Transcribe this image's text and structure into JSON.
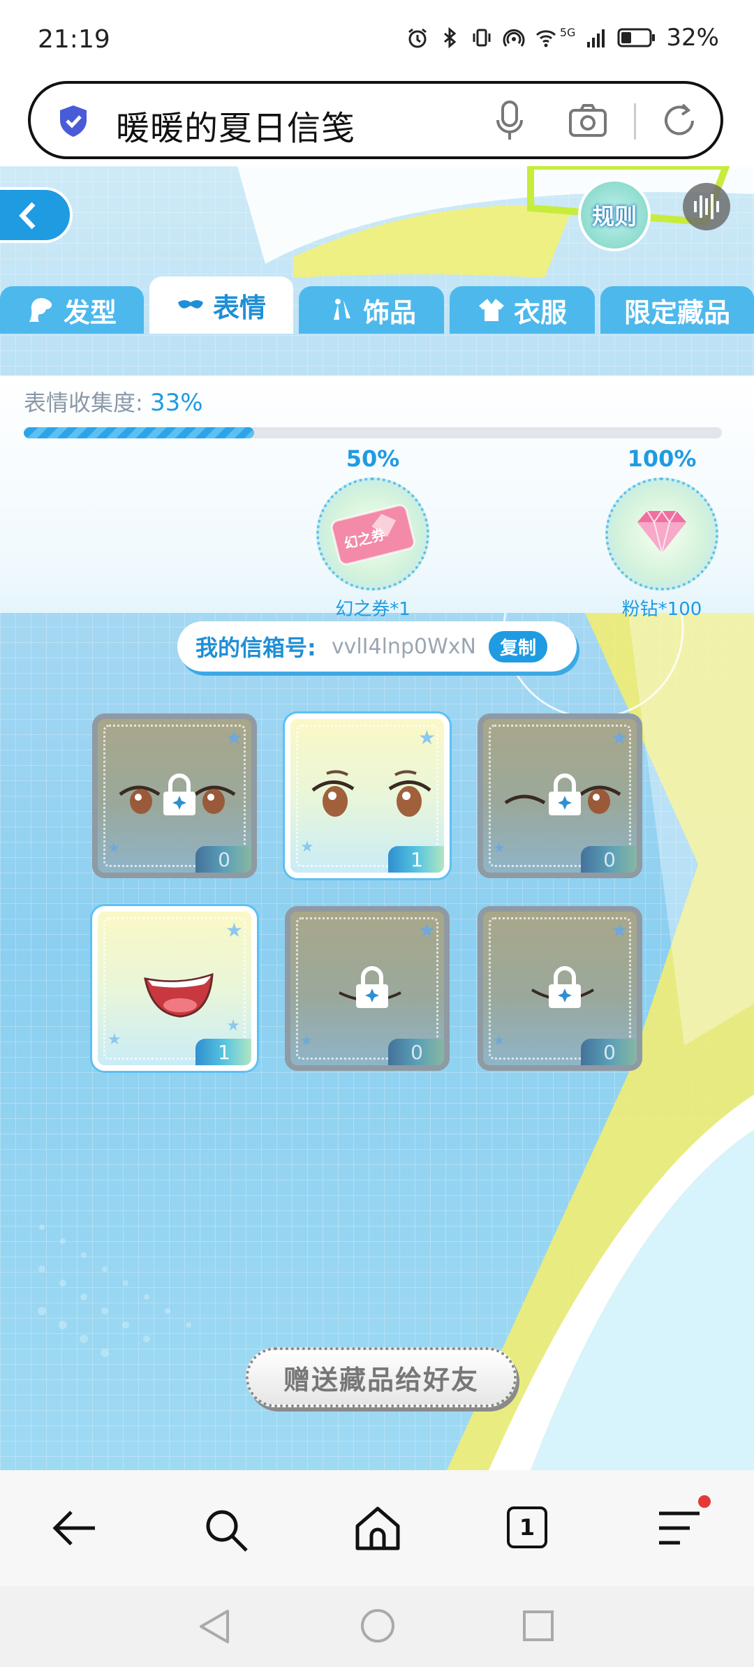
{
  "status_bar": {
    "time": "21:19",
    "network_label": "5G",
    "battery": "32%",
    "icons": [
      "alarm-icon",
      "bluetooth-icon",
      "vibrate-icon",
      "hotspot-icon",
      "wifi-icon",
      "signal-icon",
      "battery-icon"
    ]
  },
  "address_bar": {
    "title": "暖暖的夏日信笺",
    "icons": [
      "shield-icon",
      "mic-icon",
      "camera-icon",
      "reload-icon"
    ]
  },
  "game": {
    "rules_label": "规则",
    "tabs": [
      {
        "label": "发型",
        "icon": "hair-icon",
        "active": false
      },
      {
        "label": "表情",
        "icon": "mask-icon",
        "active": true
      },
      {
        "label": "饰品",
        "icon": "earring-icon",
        "active": false
      },
      {
        "label": "衣服",
        "icon": "clothes-icon",
        "active": false
      },
      {
        "label": "限定藏品",
        "icon": "",
        "active": false
      }
    ],
    "collection": {
      "label": "表情收集度:",
      "value": "33%",
      "progress_fraction": 0.33
    },
    "milestones": [
      {
        "percent": "50%",
        "reward": "幻之券*1",
        "ticket_text": "幻之券",
        "icon": "ticket-icon"
      },
      {
        "percent": "100%",
        "reward": "粉钻*100",
        "icon": "diamond-icon"
      }
    ],
    "mailbox": {
      "label": "我的信箱号:",
      "code": "vvlI4lnp0WxN",
      "copy_label": "复制"
    },
    "items": [
      {
        "type": "eyes",
        "locked": true,
        "count": "0"
      },
      {
        "type": "eyes",
        "locked": false,
        "count": "1"
      },
      {
        "type": "wink-eyes",
        "locked": true,
        "count": "0"
      },
      {
        "type": "mouth-open",
        "locked": false,
        "count": "1"
      },
      {
        "type": "mouth-smile",
        "locked": true,
        "count": "0"
      },
      {
        "type": "mouth-smile",
        "locked": true,
        "count": "0"
      }
    ],
    "gift_button": "赠送藏品给好友"
  },
  "bottom_bar": {
    "tab_count": "1",
    "icons": [
      "back-icon",
      "search-icon",
      "home-icon",
      "tabs-icon",
      "menu-icon"
    ]
  },
  "nav_bar": {
    "icons": [
      "nav-back-icon",
      "nav-home-icon",
      "nav-recents-icon"
    ]
  }
}
